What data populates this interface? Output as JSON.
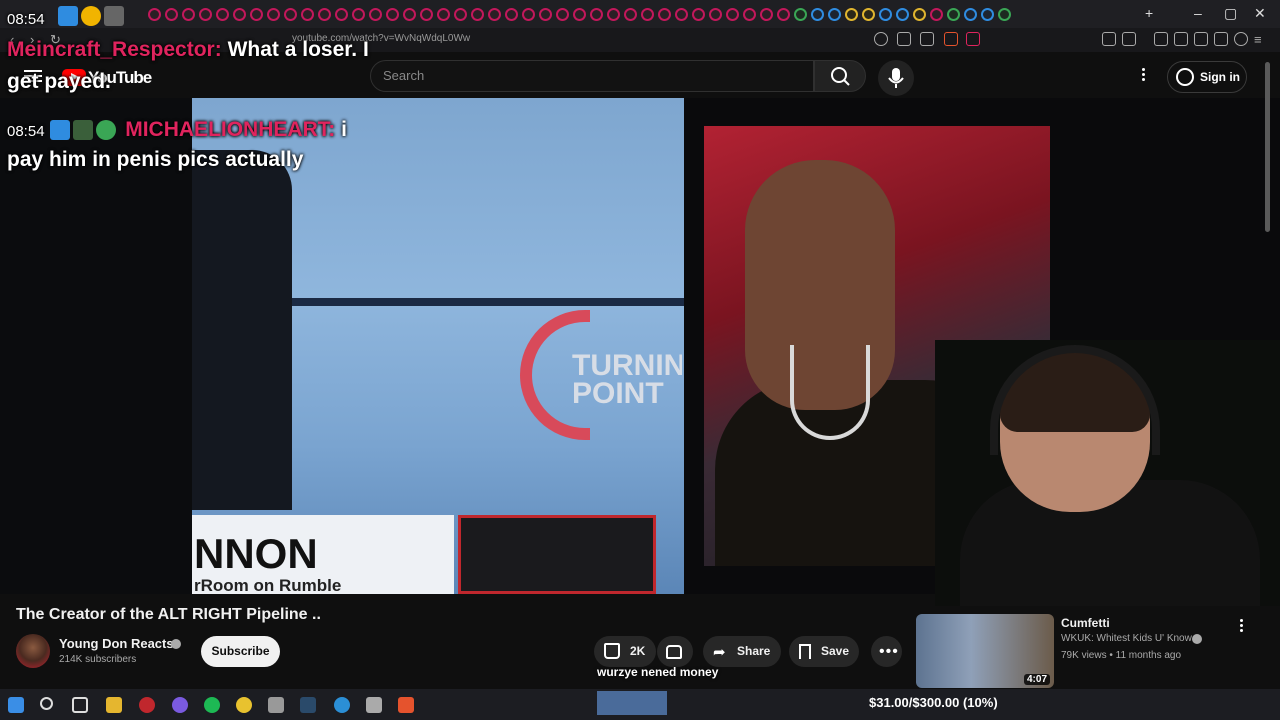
{
  "browser": {
    "url": "youtube.com/watch?v=WvNqWdqL0Ww"
  },
  "youtube": {
    "logo_text": "YouTube",
    "search_placeholder": "Search",
    "signin_label": "Sign in"
  },
  "chat": [
    {
      "time": "08:54",
      "user": "Meincraft_Respector:",
      "message_line1": "What a loser. I",
      "message_line2": "get payed.",
      "user_color": "#e0245e"
    },
    {
      "time": "08:54",
      "user": "MICHAELIONHEART:",
      "message_line1": "i",
      "message_line2": "pay him in penis pics actually",
      "user_color": "#e0245e"
    }
  ],
  "video": {
    "title": "The Creator of the ALT RIGHT Pipeline ..",
    "lower_third_title": "NNON",
    "lower_third_sub": "rRoom on Rumble",
    "brand_text": "TURNING POINT"
  },
  "channel": {
    "name": "Young Don Reacts",
    "subscribers": "214K subscribers",
    "subscribe_label": "Subscribe"
  },
  "actions": {
    "likes": "2K",
    "share_label": "Share",
    "save_label": "Save"
  },
  "caption_overlay": "wurzye nened money",
  "recommendation": {
    "title": "Cumfetti",
    "channel": "WKUK: Whitest Kids U' Know",
    "meta": "79K views • 11 months ago",
    "duration": "4:07"
  },
  "donation_goal": {
    "text": "$31.00/$300.00 (10%)",
    "progress": 0.1
  },
  "colors": {
    "accent": "#ff0000",
    "chat_name": "#e0245e",
    "bg": "#0f0f0f"
  }
}
